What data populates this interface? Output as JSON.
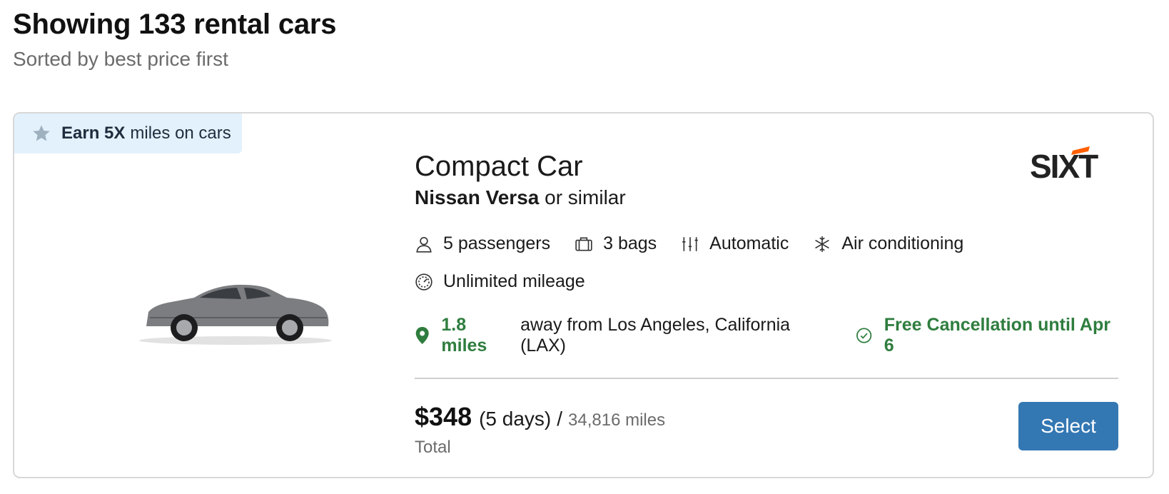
{
  "header": {
    "title": "Showing 133 rental cars",
    "subtitle": "Sorted by best price first"
  },
  "listing": {
    "promo": {
      "bold": "Earn 5X",
      "text": "miles on cars",
      "icon": "star-icon"
    },
    "car_class": "Compact Car",
    "model_bold": "Nissan Versa",
    "model_suffix": "or similar",
    "brand": "SIXT",
    "features": [
      {
        "icon": "passenger-icon",
        "label": "5 passengers"
      },
      {
        "icon": "bag-icon",
        "label": "3 bags"
      },
      {
        "icon": "transmission-icon",
        "label": "Automatic"
      },
      {
        "icon": "snowflake-icon",
        "label": "Air conditioning"
      }
    ],
    "mileage": {
      "icon": "speedometer-icon",
      "label": "Unlimited mileage"
    },
    "location": {
      "distance": "1.8 miles",
      "text": "away from Los Angeles, California (LAX)"
    },
    "cancellation": "Free Cancellation until Apr 6",
    "price": {
      "amount": "$348",
      "duration": "(5 days)",
      "separator": "/",
      "miles": "34,816 miles",
      "total_label": "Total"
    },
    "select_label": "Select"
  },
  "colors": {
    "accent": "#3377b3",
    "green": "#2f7d3e",
    "promo_bg": "#e3f1fc",
    "sixt_orange": "#ff5f00"
  }
}
